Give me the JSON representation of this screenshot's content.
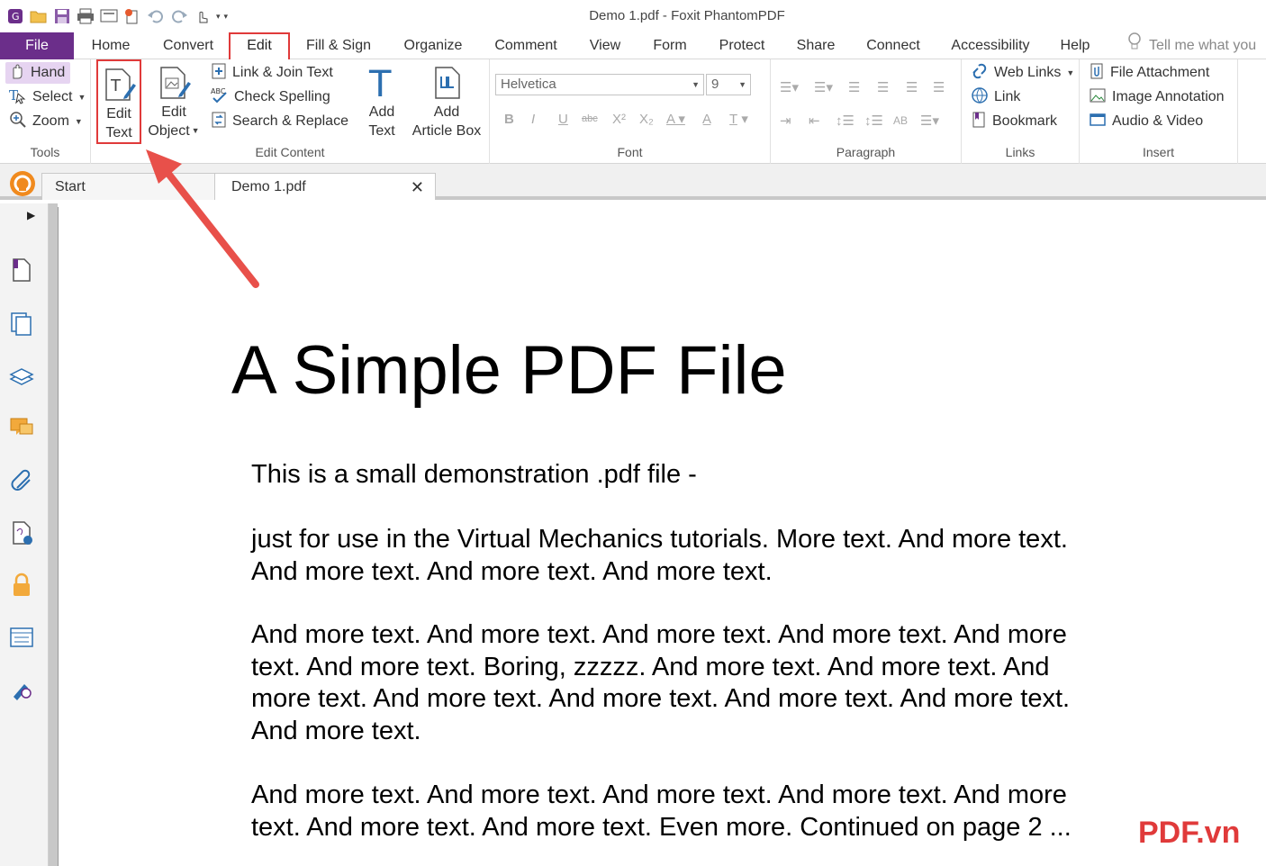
{
  "window": {
    "title": "Demo 1.pdf - Foxit PhantomPDF"
  },
  "menu": {
    "tabs": [
      "File",
      "Home",
      "Convert",
      "Edit",
      "Fill & Sign",
      "Organize",
      "Comment",
      "View",
      "Form",
      "Protect",
      "Share",
      "Connect",
      "Accessibility",
      "Help"
    ],
    "active": "Edit",
    "tell_me": "Tell me what you"
  },
  "ribbon": {
    "tools": {
      "hand": "Hand",
      "select": "Select",
      "zoom": "Zoom",
      "label": "Tools"
    },
    "edit_content": {
      "edit_text_line1": "Edit",
      "edit_text_line2": "Text",
      "edit_object_line1": "Edit",
      "edit_object_line2": "Object",
      "link_join": "Link & Join Text",
      "check_spelling": "Check Spelling",
      "search_replace": "Search & Replace",
      "add_text_line1": "Add",
      "add_text_line2": "Text",
      "add_article_line1": "Add",
      "add_article_line2": "Article Box",
      "label": "Edit Content"
    },
    "font": {
      "family": "Helvetica",
      "size": "9",
      "label": "Font"
    },
    "paragraph": {
      "label": "Paragraph"
    },
    "links": {
      "web_links": "Web Links",
      "link": "Link",
      "bookmark": "Bookmark",
      "label": "Links"
    },
    "insert": {
      "file_attachment": "File Attachment",
      "image_annotation": "Image Annotation",
      "audio_video": "Audio & Video",
      "label": "Insert"
    }
  },
  "doc_tabs": {
    "start": "Start",
    "doc": "Demo 1.pdf"
  },
  "document": {
    "title": "A Simple PDF File",
    "p1": "This is a small demonstration .pdf file -",
    "p2": "just for use in the Virtual Mechanics tutorials. More text. And more text. And more text. And more text. And more text.",
    "p3": "And more text. And more text. And more text. And more text. And more text. And more text. Boring, zzzzz. And more text. And more text. And more text. And more text. And more text. And more text. And more text. And more text.",
    "p4": "And more text. And more text. And more text. And more text. And more text. And more text. And more text. Even more. Continued on page 2 ..."
  },
  "watermark": "PDF.vn",
  "colors": {
    "file_tab": "#6b2e8a",
    "highlight": "#e03a3a",
    "hand_bg": "#e6d4f1"
  }
}
